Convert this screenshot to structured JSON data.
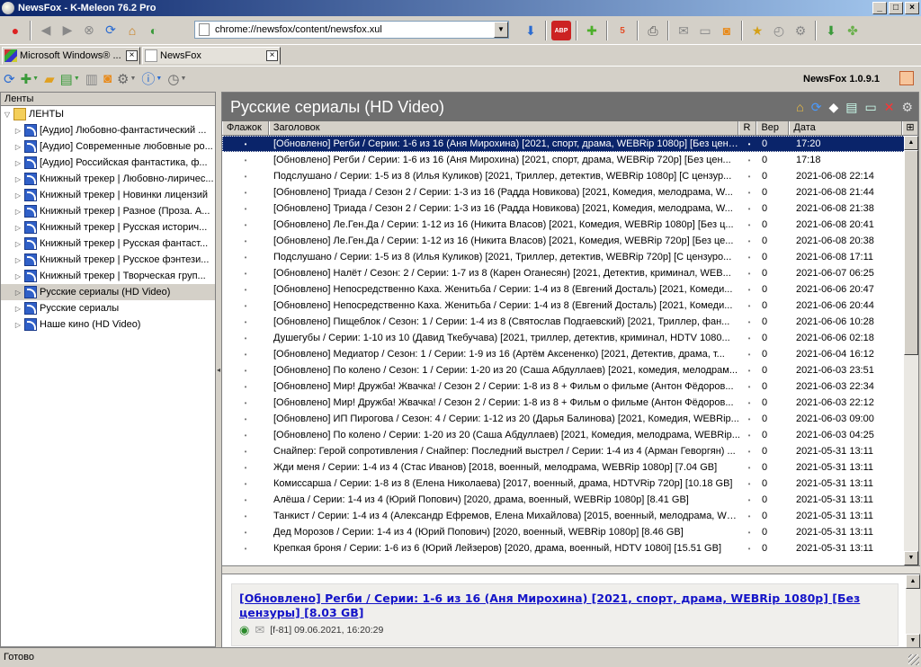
{
  "window": {
    "title": "NewsFox - K-Meleon 76.2 Pro"
  },
  "navbar": {
    "url": "chrome://newsfox/content/newsfox.xul"
  },
  "tabs": [
    {
      "label": "Microsoft Windows® ..."
    },
    {
      "label": "NewsFox"
    }
  ],
  "newsfox": {
    "version": "NewsFox 1.0.9.1"
  },
  "sidebar": {
    "header": "Ленты",
    "root": "ЛЕНТЫ",
    "items": [
      {
        "label": "[Аудио] Любовно-фантастический ..."
      },
      {
        "label": "[Аудио] Современные любовные ро..."
      },
      {
        "label": "[Аудио] Российская фантастика, ф..."
      },
      {
        "label": "Книжный трекер | Любовно-лиричес..."
      },
      {
        "label": "Книжный трекер | Новинки лицензий"
      },
      {
        "label": "Книжный трекер | Разное (Проза. А..."
      },
      {
        "label": "Книжный трекер | Русская историч..."
      },
      {
        "label": "Книжный трекер | Русская фантаст..."
      },
      {
        "label": "Книжный трекер | Русское фэнтези..."
      },
      {
        "label": "Книжный трекер | Творческая груп..."
      },
      {
        "label": "Русские сериалы (HD Video)"
      },
      {
        "label": "Русские сериалы"
      },
      {
        "label": "Наше кино (HD Video)"
      }
    ]
  },
  "feed": {
    "title": "Русские сериалы (HD Video)",
    "columns": {
      "flag": "Флажок",
      "title": "Заголовок",
      "read": "R",
      "prob": "Вер",
      "date": "Дата"
    },
    "rows": [
      {
        "flag": "•",
        "title": "[Обновлено] Регби / Серии: 1-6 из 16 (Аня Мирохина) [2021, спорт, драма, WEBRip 1080p] [Без цензуры] [8.03 GB]",
        "read": "•",
        "prob": "0",
        "date": "17:20"
      },
      {
        "flag": "•",
        "title": "[Обновлено] Регби / Серии: 1-6 из 16 (Аня Мирохина) [2021, спорт, драма, WEBRip 720p] [Без цен...",
        "read": "•",
        "prob": "0",
        "date": "17:18"
      },
      {
        "flag": "•",
        "title": "Подслушано / Серии: 1-5 из 8 (Илья Куликов) [2021, Триллер, детектив, WEBRip 1080p] [С цензур...",
        "read": "•",
        "prob": "0",
        "date": "2021-06-08 22:14"
      },
      {
        "flag": "•",
        "title": "[Обновлено] Триада / Сезон 2 / Серии: 1-3 из 16 (Радда Новикова) [2021, Комедия, мелодрама, W...",
        "read": "•",
        "prob": "0",
        "date": "2021-06-08 21:44"
      },
      {
        "flag": "•",
        "title": "[Обновлено] Триада / Сезон 2 / Серии: 1-3 из 16 (Радда Новикова) [2021, Комедия, мелодрама, W...",
        "read": "•",
        "prob": "0",
        "date": "2021-06-08 21:38"
      },
      {
        "flag": "•",
        "title": "[Обновлено] Ле.Ген.Да / Серии: 1-12 из 16 (Никита Власов) [2021, Комедия, WEBRip 1080p] [Без ц...",
        "read": "•",
        "prob": "0",
        "date": "2021-06-08 20:41"
      },
      {
        "flag": "•",
        "title": "[Обновлено] Ле.Ген.Да / Серии: 1-12 из 16 (Никита Власов) [2021, Комедия, WEBRip 720p] [Без це...",
        "read": "•",
        "prob": "0",
        "date": "2021-06-08 20:38"
      },
      {
        "flag": "•",
        "title": "Подслушано / Серии: 1-5 из 8 (Илья Куликов) [2021, Триллер, детектив, WEBRip 720p] [С цензуро...",
        "read": "•",
        "prob": "0",
        "date": "2021-06-08 17:11"
      },
      {
        "flag": "•",
        "title": "[Обновлено] Налёт / Сезон: 2 / Серии: 1-7 из 8 (Карен Оганесян) [2021, Детектив, криминал, WEB...",
        "read": "•",
        "prob": "0",
        "date": "2021-06-07 06:25"
      },
      {
        "flag": "•",
        "title": "[Обновлено] Непосредственно Каха. Женитьба / Серии: 1-4 из 8 (Евгений Досталь) [2021, Комеди...",
        "read": "•",
        "prob": "0",
        "date": "2021-06-06 20:47"
      },
      {
        "flag": "•",
        "title": "[Обновлено] Непосредственно Каха. Женитьба / Серии: 1-4 из 8 (Евгений Досталь) [2021, Комеди...",
        "read": "•",
        "prob": "0",
        "date": "2021-06-06 20:44"
      },
      {
        "flag": "•",
        "title": "[Обновлено] Пищеблок / Сезон: 1 / Серии: 1-4 из 8 (Святослав Подгаевский) [2021, Триллер, фан...",
        "read": "•",
        "prob": "0",
        "date": "2021-06-06 10:28"
      },
      {
        "flag": "•",
        "title": "Душегубы / Серии: 1-10 из 10 (Давид Ткебучава) [2021, триллер, детектив, криминал, HDTV 1080...",
        "read": "•",
        "prob": "0",
        "date": "2021-06-06 02:18"
      },
      {
        "flag": "•",
        "title": "[Обновлено] Медиатор / Сезон: 1 / Серии: 1-9 из 16 (Артём Аксененко) [2021, Детектив, драма, т...",
        "read": "•",
        "prob": "0",
        "date": "2021-06-04 16:12"
      },
      {
        "flag": "•",
        "title": "[Обновлено] По колено / Сезон: 1 / Серии: 1-20 из 20 (Саша Абдуллаев) [2021, комедия, мелодрам...",
        "read": "•",
        "prob": "0",
        "date": "2021-06-03 23:51"
      },
      {
        "flag": "•",
        "title": "[Обновлено] Мир! Дружба! Жвачка! / Сезон 2 / Серии: 1-8 из 8 + Фильм о фильме (Антон Фёдоров...",
        "read": "•",
        "prob": "0",
        "date": "2021-06-03 22:34"
      },
      {
        "flag": "•",
        "title": "[Обновлено] Мир! Дружба! Жвачка! / Сезон 2 / Серии: 1-8 из 8 + Фильм о фильме (Антон Фёдоров...",
        "read": "•",
        "prob": "0",
        "date": "2021-06-03 22:12"
      },
      {
        "flag": "•",
        "title": "[Обновлено] ИП Пирогова / Сезон: 4 / Серии: 1-12 из 20 (Дарья Балинова) [2021, Комедия, WEBRip...",
        "read": "•",
        "prob": "0",
        "date": "2021-06-03 09:00"
      },
      {
        "flag": "•",
        "title": "[Обновлено] По колено / Серии: 1-20 из 20 (Саша Абдуллаев) [2021, Комедия, мелодрама, WEBRip...",
        "read": "•",
        "prob": "0",
        "date": "2021-06-03 04:25"
      },
      {
        "flag": "•",
        "title": "Снайпер: Герой сопротивления / Снайпер: Последний выстрел / Серии: 1-4 из 4 (Арман Геворгян) ...",
        "read": "•",
        "prob": "0",
        "date": "2021-05-31 13:11"
      },
      {
        "flag": "•",
        "title": "Жди меня / Серии: 1-4 из 4 (Стас Иванов) [2018, военный, мелодрама, WEBRip 1080p] [7.04 GB]",
        "read": "•",
        "prob": "0",
        "date": "2021-05-31 13:11"
      },
      {
        "flag": "•",
        "title": "Комиссарша / Серии: 1-8 из 8 (Елена Николаева) [2017, военный, драма, HDTVRip 720p] [10.18 GB]",
        "read": "•",
        "prob": "0",
        "date": "2021-05-31 13:11"
      },
      {
        "flag": "•",
        "title": "Алёша / Серии: 1-4 из 4 (Юрий Попович) [2020, драма, военный, WEBRip 1080p] [8.41 GB]",
        "read": "•",
        "prob": "0",
        "date": "2021-05-31 13:11"
      },
      {
        "flag": "•",
        "title": "Танкист / Серии: 1-4 из 4 (Александр Ефремов, Елена Михайлова) [2015, военный, мелодрама, WE...",
        "read": "•",
        "prob": "0",
        "date": "2021-05-31 13:11"
      },
      {
        "flag": "•",
        "title": "Дед Морозов / Серии: 1-4 из 4 (Юрий Попович) [2020, военный, WEBRip 1080p] [8.46 GB]",
        "read": "•",
        "prob": "0",
        "date": "2021-05-31 13:11"
      },
      {
        "flag": "•",
        "title": "Крепкая броня / Серии: 1-6 из 6 (Юрий Лейзеров) [2020, драма, военный, HDTV 1080i] [15.51 GB]",
        "read": "•",
        "prob": "0",
        "date": "2021-05-31 13:11"
      }
    ]
  },
  "preview": {
    "title": "[Обновлено] Регби / Серии: 1-6 из 16 (Аня Мирохина) [2021, спорт, драма, WEBRip 1080p] [Без цензуры] [8.03 GB]",
    "meta": "[f-81] 09.06.2021, 16:20:29"
  },
  "status": {
    "text": "Готово"
  }
}
